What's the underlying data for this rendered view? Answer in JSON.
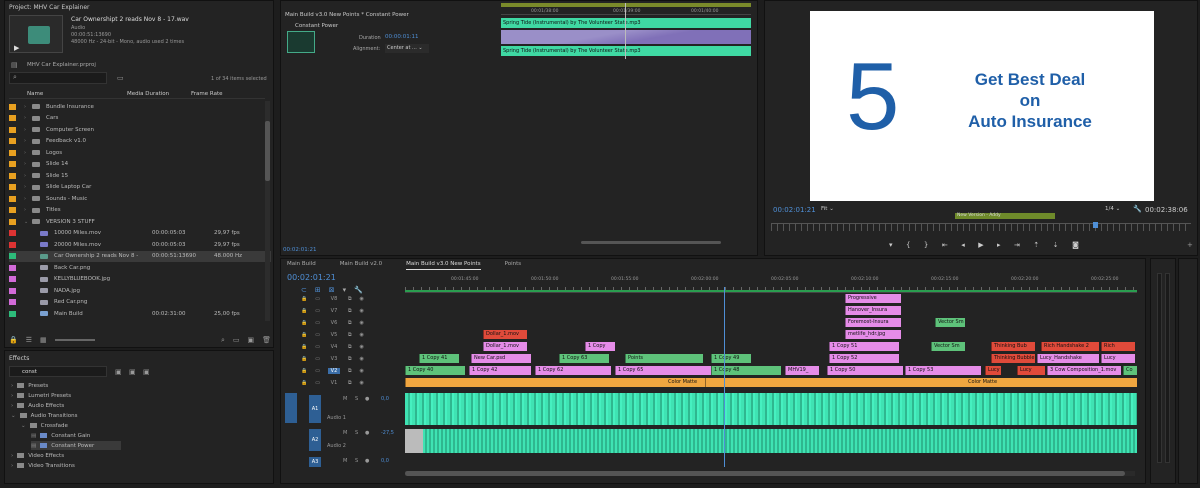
{
  "project": {
    "title": "Project: MHV Car Explainer",
    "clip_name": "Car Ownershipt 2 reads  Nov 8 - 17.wav",
    "clip_type": "Audio",
    "clip_timecode": "00:00:51:13690",
    "clip_format": "48000 Hz - 24-bit - Mono",
    "clip_usage": ", audio used 2 times",
    "project_file": "MHV Car Explainer.prproj",
    "search_placeholder": "",
    "item_count": "1 of 34 items selected",
    "headers": {
      "name": "Name",
      "duration": "Media Duration",
      "frame_rate": "Frame Rate"
    },
    "rows": [
      {
        "name": "Bundle Insurance",
        "duration": "",
        "fr": "",
        "color": "#e8a020",
        "kind": "folder"
      },
      {
        "name": "Cars",
        "duration": "",
        "fr": "",
        "color": "#e8a020",
        "kind": "folder"
      },
      {
        "name": "Computer Screen",
        "duration": "",
        "fr": "",
        "color": "#e8a020",
        "kind": "folder"
      },
      {
        "name": "Feedback v1.0",
        "duration": "",
        "fr": "",
        "color": "#e8a020",
        "kind": "folder"
      },
      {
        "name": "Logos",
        "duration": "",
        "fr": "",
        "color": "#e8a020",
        "kind": "folder"
      },
      {
        "name": "Slide 14",
        "duration": "",
        "fr": "",
        "color": "#e8a020",
        "kind": "folder"
      },
      {
        "name": "Slide 15",
        "duration": "",
        "fr": "",
        "color": "#e8a020",
        "kind": "folder"
      },
      {
        "name": "Slide Laptop Car",
        "duration": "",
        "fr": "",
        "color": "#e8a020",
        "kind": "folder"
      },
      {
        "name": "Sounds - Music",
        "duration": "",
        "fr": "",
        "color": "#e8a020",
        "kind": "folder"
      },
      {
        "name": "Titles",
        "duration": "",
        "fr": "",
        "color": "#e8a020",
        "kind": "folder"
      },
      {
        "name": "VERSION 3 STUFF",
        "duration": "",
        "fr": "",
        "color": "#e8a020",
        "kind": "folder-open"
      },
      {
        "name": "10000 Miles.mov",
        "duration": "00:00:05:03",
        "fr": "29,97 fps",
        "color": "#d33",
        "kind": "file"
      },
      {
        "name": "20000 Miles.mov",
        "duration": "00:00:05:03",
        "fr": "29,97 fps",
        "color": "#d33",
        "kind": "file"
      },
      {
        "name": "Car Ownership 2 reads  Nov 8 -",
        "duration": "00:00:51:13690",
        "fr": "48.000 Hz",
        "color": "#2dbb7a",
        "kind": "audio"
      },
      {
        "name": "Back Car.png",
        "duration": "",
        "fr": "",
        "color": "#d26ad8",
        "kind": "img"
      },
      {
        "name": "KELLYBLUEBOOK.jpg",
        "duration": "",
        "fr": "",
        "color": "#d26ad8",
        "kind": "img"
      },
      {
        "name": "NADA.jpg",
        "duration": "",
        "fr": "",
        "color": "#d26ad8",
        "kind": "img"
      },
      {
        "name": "Red Car.png",
        "duration": "",
        "fr": "",
        "color": "#d26ad8",
        "kind": "img"
      },
      {
        "name": "Main Build",
        "duration": "00:02:31:00",
        "fr": "25,00 fps",
        "color": "#2dbb7a",
        "kind": "seq"
      }
    ]
  },
  "effects": {
    "title": "Effects",
    "search_value": "const",
    "items": [
      {
        "label": "Presets",
        "level": 0
      },
      {
        "label": "Lumetri Presets",
        "level": 0
      },
      {
        "label": "Audio Effects",
        "level": 0
      },
      {
        "label": "Audio Transitions",
        "level": 0
      },
      {
        "label": "Crossfade",
        "level": 1
      },
      {
        "label": "Constant Gain",
        "level": 2
      },
      {
        "label": "Constant Power",
        "level": 2
      },
      {
        "label": "Video Effects",
        "level": 0
      },
      {
        "label": "Video Transitions",
        "level": 0
      }
    ]
  },
  "effect_controls": {
    "tab": "Main Build v3.0 New Points * Constant Power",
    "effect_name": "Constant Power",
    "duration_label": "Duration",
    "duration_value": "00:00:01:11",
    "alignment_label": "Alignment:",
    "alignment_value": "Center at ...",
    "audio_clip_1": "Spring Tide (Instrumental) by The Volunteer State.mp3",
    "audio_clip_2": "Spring Tide (Instrumental) by The Volunteer State.mp3",
    "ruler": [
      "00:01/38:00",
      "00:01/39:00",
      "00:01/40:00"
    ],
    "timecode": "00:02:01:21"
  },
  "program": {
    "slide_number": "5",
    "slide_line1": "Get Best Deal",
    "slide_line2": "on",
    "slide_line3": "Auto Insurance",
    "timecode": "00:02:01:21",
    "fit": "Fit",
    "scale": "1/4",
    "duration": "00:02:38:06",
    "marker_label": "New Version - Addy"
  },
  "timeline": {
    "tabs": [
      "Main Build",
      "Main Build v2.0",
      "Main Build v3.0 New Points",
      "Points"
    ],
    "timecode": "00:02:01:21",
    "ruler": [
      "00:01:45:00",
      "00:01:50:00",
      "00:01:55:00",
      "00:02:00:00",
      "00:02:05:00",
      "00:02:10:00",
      "00:02:15:00",
      "00:02:20:00",
      "00:02:25:00"
    ],
    "video_tracks": [
      "V8",
      "V7",
      "V6",
      "V5",
      "V4",
      "V3",
      "V2",
      "V1"
    ],
    "audio_tracks": [
      "A1",
      "A2",
      "A3"
    ],
    "audio_names": [
      "Audio 1",
      "Audio 2"
    ],
    "audio_vol": [
      "0,0",
      "-27,5",
      "0,0"
    ],
    "clips": {
      "v8": [
        "Progressive"
      ],
      "v7": [
        "Hanover_Insura"
      ],
      "v6": [
        "Foremost-Insura",
        "Vector Sm"
      ],
      "v5": [
        "Dollar_1.mov",
        "metlife_hdr.jpg"
      ],
      "v4": [
        "Dollar_1.mov",
        "1 Copy",
        "1 Copy 51",
        "Vector Sm",
        "Thinking Bub",
        "Rich Handshake 2",
        "Rich"
      ],
      "v3": [
        "1 Copy 41",
        "New Car.psd",
        "1 Copy 63",
        "Points",
        "1 Copy 49",
        "1 Copy 52",
        "Thinking Bubble",
        "Lucy_Handshake",
        "Lucy"
      ],
      "v2": [
        "1 Copy 40",
        "1 Copy 42",
        "1 Copy 62",
        "1 Copy 65",
        "1 Copy 48",
        "MHV19_",
        "1 Copy 50",
        "1 Copy 53",
        "Lucy Think",
        "Lucy",
        "3 Cow Composition_1.mov",
        "Co"
      ],
      "v1": [
        "Color Matte",
        "Color Matte"
      ]
    }
  },
  "colors": {
    "accent": "#4f8fd6",
    "audio": "#3fe3b3",
    "video_pink": "#e58ce8",
    "video_green": "#5ec27a",
    "video_red": "#e04a3a",
    "matte": "#f0a640"
  }
}
